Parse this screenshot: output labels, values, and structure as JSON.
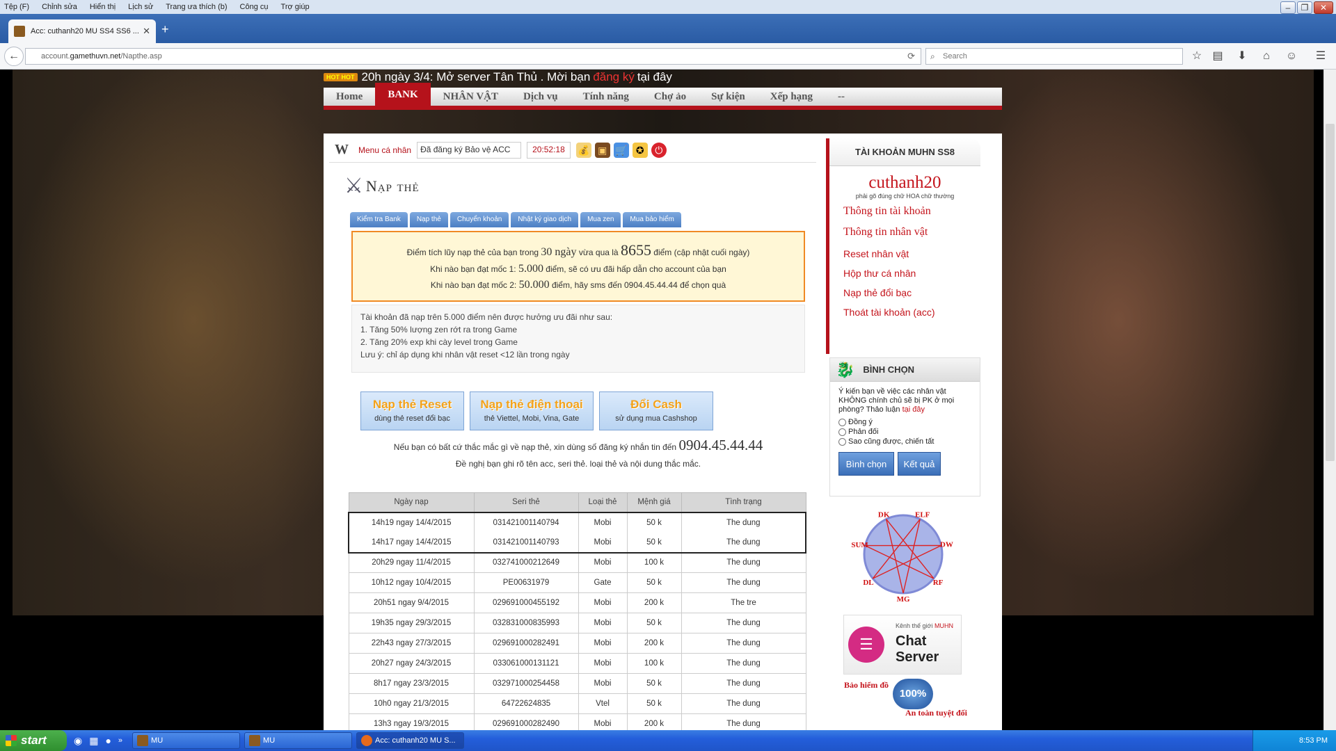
{
  "browser": {
    "menu": [
      "Tệp (F)",
      "Chỉnh sửa",
      "Hiển thị",
      "Lịch sử",
      "Trang ưa thích (b)",
      "Công cụ",
      "Trợ giúp"
    ],
    "tab_title": "Acc: cuthanh20 MU SS4 SS6 ...",
    "url_prefix": "account.",
    "url_domain": "gamethuvn.net",
    "url_path": "/Napthe.asp",
    "search_placeholder": "Search"
  },
  "site": {
    "hot_badge": "HOT HOT",
    "hot_text_1": "20h ngày 3/4: Mở server Tân Thủ . Mời bạn",
    "hot_link": "đăng ký",
    "hot_text_2": "tại đây",
    "nav": [
      "Home",
      "BANK",
      "NHÂN VẬT",
      "Dịch vụ",
      "Tính năng",
      "Chợ ảo",
      "Sự kiện",
      "Xếp hạng",
      "--"
    ],
    "nav_active": "BANK"
  },
  "subbar": {
    "menu_label": "Menu cá nhân",
    "select_value": "Đã đăng ký Bảo vệ ACC",
    "clock": "20:52:18"
  },
  "page": {
    "title": "Nạp thẻ",
    "tabs": [
      "Kiểm tra Bank",
      "Nạp thẻ",
      "Chuyển khoản",
      "Nhật ký giao dịch",
      "Mua zen",
      "Mua bảo hiểm"
    ]
  },
  "notice1": {
    "line1_a": "Điểm tích lũy nạp thẻ của bạn trong",
    "line1_days": "30 ngày",
    "line1_b": "vừa qua là",
    "line1_points": "8655",
    "line1_c": "điểm (cập nhật cuối ngày)",
    "line2_a": "Khi nào bạn đạt mốc 1:",
    "line2_num": "5.000",
    "line2_b": "điểm, sẽ có ưu đãi hấp dẫn cho account của bạn",
    "line3_a": "Khi nào bạn đạt mốc 2:",
    "line3_num": "50.000",
    "line3_b": "điểm, hãy sms đến 0904.45.44.44 để chọn quà"
  },
  "notice2": {
    "lines": [
      "Tài khoản đã nạp trên 5.000 điểm nên được hưởng ưu đãi như sau:",
      "1. Tăng 50% lượng zen rớt ra trong Game",
      "2. Tăng 20% exp khi cày level trong Game",
      "Lưu ý: chỉ áp dụng khi nhân vật reset <12 lần trong ngày"
    ]
  },
  "buttons": {
    "reset_title": "Nạp thẻ Reset",
    "reset_sub": "dùng thẻ reset đổi bạc",
    "phone_title": "Nạp thẻ điện thoại",
    "phone_sub": "thẻ Viettel, Mobi, Vina, Gate",
    "cash_title": "Đổi Cash",
    "cash_sub": "sử dụng mua Cashshop"
  },
  "help": {
    "line1": "Nếu bạn có bất cứ thắc mắc gì về nạp thẻ, xin dùng số đăng ký nhắn tin đến",
    "phone": "0904.45.44.44",
    "line2": "Đề nghị bạn ghi rõ tên acc, seri thẻ. loại thẻ và nội dung thắc mắc."
  },
  "table": {
    "headers": [
      "Ngày nạp",
      "Seri thẻ",
      "Loại thẻ",
      "Mệnh giá",
      "Tình trạng"
    ],
    "rows": [
      [
        "14h19 ngay 14/4/2015",
        "031421001140794",
        "Mobi",
        "50 k",
        "The dung"
      ],
      [
        "14h17 ngay 14/4/2015",
        "031421001140793",
        "Mobi",
        "50 k",
        "The dung"
      ],
      [
        "20h29 ngay 11/4/2015",
        "032741000212649",
        "Mobi",
        "100 k",
        "The dung"
      ],
      [
        "10h12 ngay 10/4/2015",
        "PE00631979",
        "Gate",
        "50 k",
        "The dung"
      ],
      [
        "20h51 ngay 9/4/2015",
        "029691000455192",
        "Mobi",
        "200 k",
        "The tre"
      ],
      [
        "19h35 ngay 29/3/2015",
        "032831000835993",
        "Mobi",
        "50 k",
        "The dung"
      ],
      [
        "22h43 ngay 27/3/2015",
        "029691000282491",
        "Mobi",
        "200 k",
        "The dung"
      ],
      [
        "20h27 ngay 24/3/2015",
        "033061000131121",
        "Mobi",
        "100 k",
        "The dung"
      ],
      [
        "8h17 ngay 23/3/2015",
        "032971000254458",
        "Mobi",
        "50 k",
        "The dung"
      ],
      [
        "10h0 ngay 21/3/2015",
        "64722624835",
        "Vtel",
        "50 k",
        "The dung"
      ],
      [
        "13h3 ngay 19/3/2015",
        "029691000282490",
        "Mobi",
        "200 k",
        "The dung"
      ]
    ]
  },
  "account": {
    "header": "TÀI KHOẢN MUHN SS8",
    "username": "cuthanh20",
    "hint": "phải gõ đúng chữ HOA chữ thường",
    "links": [
      "Thông tin tài khoản",
      "Thông tin nhân vật",
      "Reset nhân vật",
      "Hộp thư cá nhân",
      "Nạp thẻ đổi bạc",
      "Thoát tài khoản (acc)"
    ]
  },
  "vote": {
    "header": "BÌNH CHỌN",
    "question": "Ý kiến bạn về việc các nhân vật KHÔNG chính chủ sẽ bị PK ở mọi phòng? Thảo luận",
    "question_link": "tại đây",
    "options": [
      "Đồng ý",
      "Phản đối",
      "Sao cũng được, chiến tất"
    ],
    "vote_button": "Bình chọn",
    "result_button": "Kết quả"
  },
  "class_diagram": {
    "labels": [
      "DK",
      "ELF",
      "DW",
      "RF",
      "MG",
      "DL",
      "SUM"
    ]
  },
  "chat": {
    "sub": "Kênh thế giới",
    "brand": "MUHN",
    "title": "Chat Server"
  },
  "insurance": {
    "line1": "Bảo hiểm đồ",
    "seal": "100%",
    "line2": "An toàn tuyệt đối"
  },
  "taskbar": {
    "start": "start",
    "items": [
      "MU",
      "MU",
      "Acc: cuthanh20 MU S..."
    ],
    "clock": "8:53 PM"
  }
}
